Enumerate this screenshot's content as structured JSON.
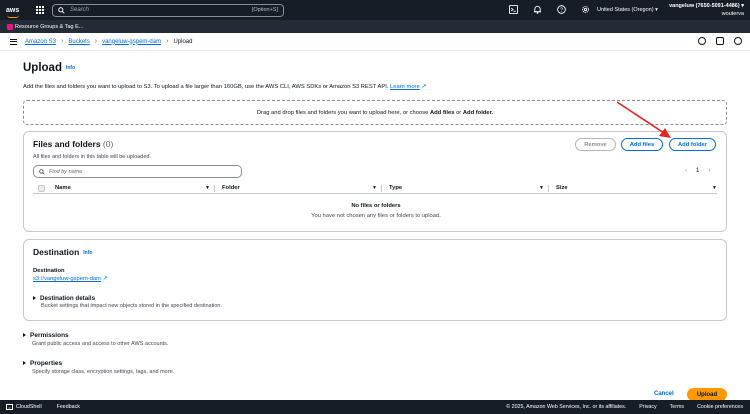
{
  "topnav": {
    "logo_text": "aws",
    "search_placeholder": "Search",
    "search_shortcut": "[Option+S]",
    "region": "United States (Oregon) ▾",
    "account_name": "vangeluw (7650-5091-4486) ▾",
    "account_sub": "wouterva",
    "icons": [
      "cloudshell-icon",
      "bell-icon",
      "help-icon",
      "settings-icon"
    ]
  },
  "bookmark": {
    "label": "Resource Groups & Tag E..."
  },
  "breadcrumb": {
    "items": [
      "Amazon S3",
      "Buckets",
      "vangeluw-gspem-dam",
      "Upload"
    ]
  },
  "page": {
    "title": "Upload",
    "info": "Info",
    "description_prefix": "Add the files and folders you want to upload to S3. To upload a file larger than 160GB, use the AWS CLI, AWS SDKs or Amazon S3 REST API.",
    "learn_more": "Learn more",
    "dropzone_prefix": "Drag and drop files and folders you want to upload here, or choose",
    "dropzone_files": "Add files",
    "dropzone_or": "or",
    "dropzone_folder": "Add folder."
  },
  "files_panel": {
    "title": "Files and folders",
    "count": "(0)",
    "subtitle": "All files and folders in this table will be uploaded.",
    "remove": "Remove",
    "add_files": "Add files",
    "add_folder": "Add folder",
    "find_placeholder": "Find by name",
    "page": "1",
    "columns": [
      "Name",
      "Folder",
      "Type",
      "Size"
    ],
    "empty_title": "No files or folders",
    "empty_text": "You have not chosen any files or folders to upload."
  },
  "destination": {
    "title": "Destination",
    "info": "Info",
    "label": "Destination",
    "link": "s3://vangeluw-gspem-dam",
    "details_title": "Destination details",
    "details_sub": "Bucket settings that impact new objects stored in the specified destination."
  },
  "permissions": {
    "title": "Permissions",
    "sub": "Grant public access and access to other AWS accounts."
  },
  "properties": {
    "title": "Properties",
    "sub": "Specify storage class, encryption settings, tags, and more."
  },
  "actions": {
    "cancel": "Cancel",
    "upload": "Upload"
  },
  "footer": {
    "cloudshell": "CloudShell",
    "feedback": "Feedback",
    "copyright": "© 2025, Amazon Web Services, Inc. or its affiliates.",
    "privacy": "Privacy",
    "terms": "Terms",
    "cookies": "Cookie preferences"
  },
  "colors": {
    "accent": "#006ce0",
    "primary_button": "#ff9900",
    "nav_bg": "#161d26",
    "annotation_arrow": "#e3261b"
  }
}
